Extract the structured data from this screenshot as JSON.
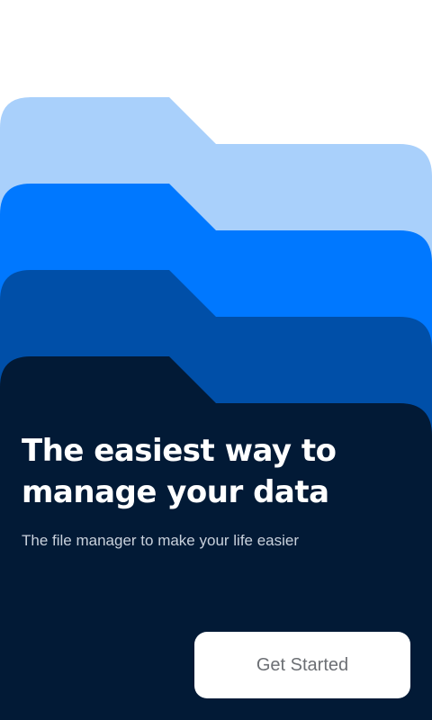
{
  "theme": {
    "background": "#ffffff",
    "folder_light": "#a9d0fb",
    "folder_bright": "#0078ff",
    "folder_mid": "#004fa8",
    "folder_dark": "#021a36",
    "button_bg": "#ffffff",
    "button_text": "#6c6f74"
  },
  "hero": {
    "headline_line1": "The easiest way to",
    "headline_line2": "manage your data",
    "subtitle": "The file manager to make your life easier"
  },
  "actions": {
    "primary_label": "Get Started"
  }
}
